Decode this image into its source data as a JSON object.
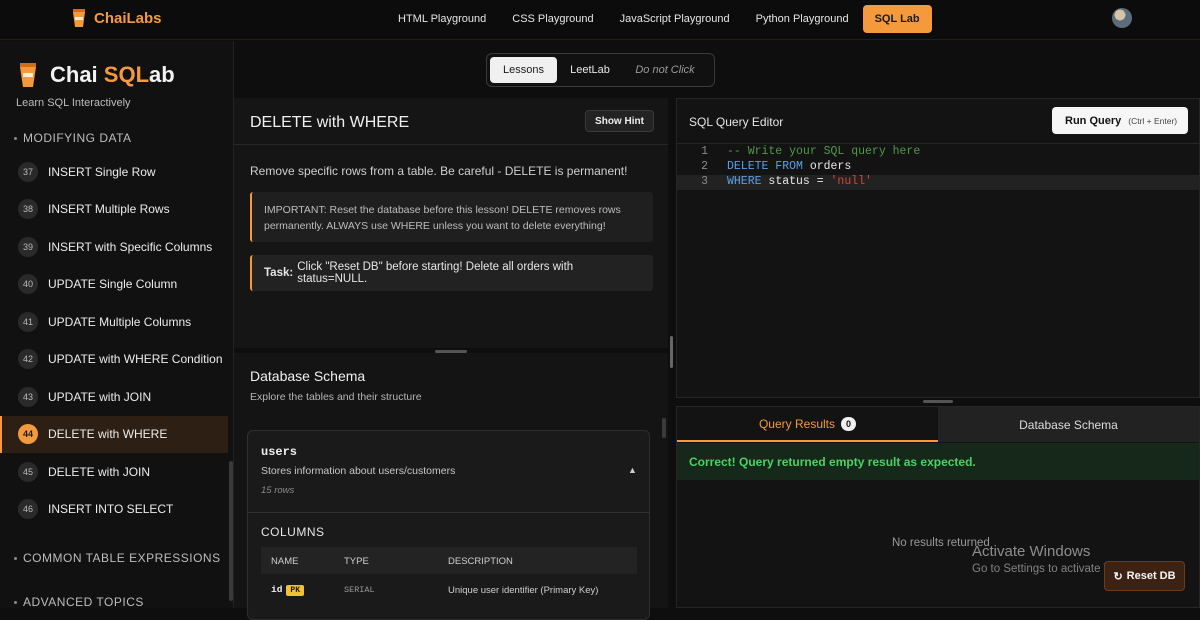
{
  "nav": {
    "brand": "ChaiLabs",
    "links": [
      {
        "label": "HTML Playground"
      },
      {
        "label": "CSS Playground"
      },
      {
        "label": "JavaScript Playground"
      },
      {
        "label": "Python Playground"
      },
      {
        "label": "SQL Lab",
        "active": true
      }
    ]
  },
  "sidebar": {
    "title_prefix": "Chai ",
    "title_highlight": "SQL",
    "title_suffix": "ab",
    "subtitle": "Learn SQL Interactively",
    "section_current": "MODIFYING DATA",
    "items": [
      {
        "num": "37",
        "label": "INSERT Single Row"
      },
      {
        "num": "38",
        "label": "INSERT Multiple Rows"
      },
      {
        "num": "39",
        "label": "INSERT with Specific Columns"
      },
      {
        "num": "40",
        "label": "UPDATE Single Column"
      },
      {
        "num": "41",
        "label": "UPDATE Multiple Columns"
      },
      {
        "num": "42",
        "label": "UPDATE with WHERE Condition"
      },
      {
        "num": "43",
        "label": "UPDATE with JOIN"
      },
      {
        "num": "44",
        "label": "DELETE with WHERE",
        "active": true
      },
      {
        "num": "45",
        "label": "DELETE with JOIN"
      },
      {
        "num": "46",
        "label": "INSERT INTO SELECT"
      }
    ],
    "section_cte": "COMMON TABLE EXPRESSIONS",
    "section_adv": "ADVANCED TOPICS"
  },
  "switcher": {
    "lessons": "Lessons",
    "leetlab": "LeetLab",
    "do_not_click": "Do not Click"
  },
  "lesson": {
    "title": "DELETE with WHERE",
    "hint_button": "Show Hint",
    "description": "Remove specific rows from a table. Be careful - DELETE is permanent!",
    "warning": "IMPORTANT: Reset the database before this lesson! DELETE removes rows permanently. ALWAYS use WHERE unless you want to delete everything!",
    "task_label": "Task:",
    "task_text": "Click \"Reset DB\" before starting! Delete all orders with status=NULL."
  },
  "schema": {
    "title": "Database Schema",
    "subtitle": "Explore the tables and their structure",
    "table_name": "users",
    "table_desc": "Stores information about users/customers",
    "table_rows": "15 rows",
    "columns_label": "COLUMNS",
    "col_headers": [
      "NAME",
      "TYPE",
      "DESCRIPTION"
    ],
    "first_col": {
      "name": "id",
      "badge": "PK",
      "type": "SERIAL",
      "desc": "Unique user identifier (Primary Key)"
    }
  },
  "editor": {
    "title": "SQL Query Editor",
    "run_label": "Run Query",
    "run_shortcut": "(Ctrl + Enter)",
    "line_numbers": [
      "1",
      "2",
      "3"
    ],
    "line1_comment": "-- Write your SQL query here",
    "line2_kw": "DELETE FROM",
    "line2_rest": " orders",
    "line3_kw": "WHERE",
    "line3_mid": " status = ",
    "line3_str": "'null'"
  },
  "results": {
    "tab_results": "Query Results",
    "count": "0",
    "tab_schema": "Database Schema",
    "success": "Correct! Query returned empty result as expected.",
    "empty": "No results returned"
  },
  "overlay": {
    "activate_title": "Activate Windows",
    "activate_sub": "Go to Settings to activate Windows.",
    "reset_label": "Reset DB"
  },
  "colors": {
    "accent": "#f59a3c",
    "success": "#4cd167",
    "keyword": "#5aa0e8",
    "comment": "#4f9b45",
    "string": "#d7443a"
  }
}
